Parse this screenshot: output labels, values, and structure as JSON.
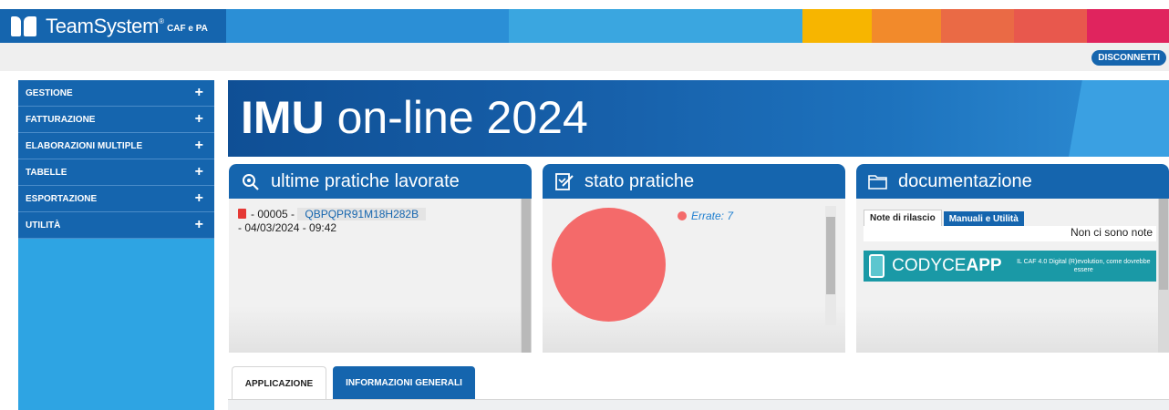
{
  "header": {
    "brand_name": "TeamSystem",
    "brand_sub": "CAF e PA",
    "colors": [
      "#1565ae",
      "#2b8fd6",
      "#3aa6e0",
      "#3aa6e0",
      "#f7b500",
      "#f28a2b",
      "#e8584d",
      "#e0245e"
    ]
  },
  "toolbar": {
    "disconnect_label": "DISCONNETTI"
  },
  "sidebar": {
    "items": [
      {
        "label": "GESTIONE",
        "icon": "+"
      },
      {
        "label": "FATTURAZIONE",
        "icon": "+"
      },
      {
        "label": "ELABORAZIONI MULTIPLE",
        "icon": "+"
      },
      {
        "label": "TABELLE",
        "icon": "+"
      },
      {
        "label": "ESPORTAZIONE",
        "icon": "+"
      },
      {
        "label": "UTILITÀ",
        "icon": "+"
      }
    ]
  },
  "banner": {
    "title_bold": "IMU",
    "title_rest": "on-line 2024"
  },
  "panels": {
    "recent": {
      "title": "ultime pratiche lavorate",
      "icon": "search-gear-icon",
      "item": {
        "number": "- 00005  -",
        "code": "QBPQPR91M18H282B",
        "date": "- 04/03/2024 - 09:42"
      }
    },
    "status": {
      "title": "stato pratiche",
      "icon": "edit-document-icon",
      "legend": "Errate: 7",
      "color": "#f46a6a"
    },
    "docs": {
      "title": "documentazione",
      "icon": "folder-icon",
      "tabs": [
        "Note di rilascio",
        "Manuali e Utilità"
      ],
      "notes": "Non ci sono note",
      "promo": {
        "bold": "APP",
        "name": "CODYCE",
        "tagline": "IL CAF 4.0 Digital (R)evolution, come dovrebbe essere"
      }
    }
  },
  "bottom_tabs": [
    "APPLICAZIONE",
    "INFORMAZIONI GENERALI"
  ],
  "chart_data": {
    "type": "pie",
    "categories": [
      "Errate"
    ],
    "values": [
      7
    ],
    "title": ""
  }
}
